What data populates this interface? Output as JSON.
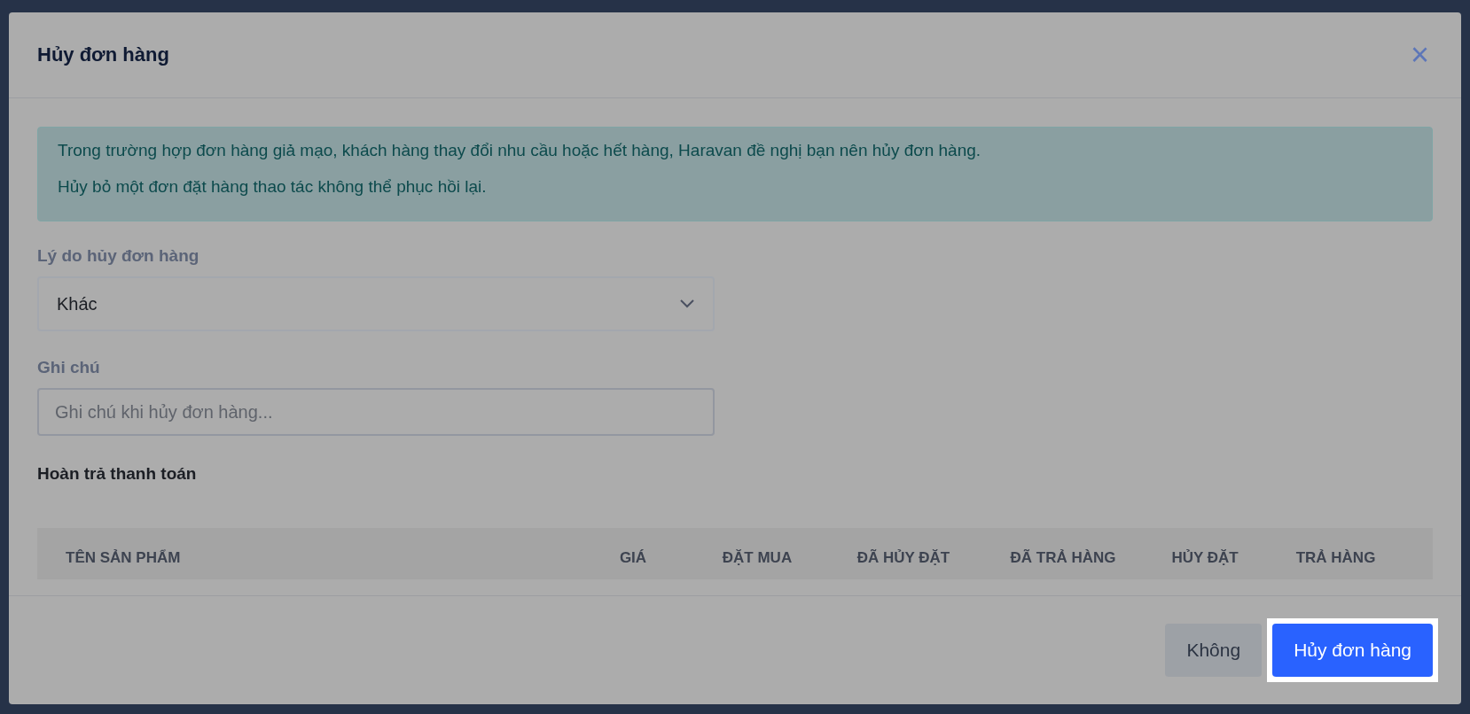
{
  "dialog": {
    "title": "Hủy đơn hàng",
    "close": "×"
  },
  "notice": [
    "Trong trường hợp đơn hàng giả mạo, khách hàng thay đổi nhu cầu hoặc hết hàng, Haravan đề nghị bạn nên hủy đơn hàng.",
    "Hủy bỏ một đơn đặt hàng thao tác không thể phục hồi lại."
  ],
  "reason": {
    "label": "Lý do hủy đơn hàng",
    "value": "Khác"
  },
  "note": {
    "label": "Ghi chú",
    "placeholder": "Ghi chú khi hủy đơn hàng..."
  },
  "refund": {
    "title": "Hoàn trả thanh toán",
    "columns": [
      "TÊN SẢN PHẨM",
      "GIÁ",
      "ĐẶT MUA",
      "ĐÃ HỦY ĐẶT",
      "ĐÃ TRẢ HÀNG",
      "HỦY ĐẶT",
      "TRẢ HÀNG"
    ]
  },
  "buttons": [
    {
      "label": "Không",
      "kind": "secondary",
      "highlighted": false
    },
    {
      "label": "Hủy đơn hàng",
      "kind": "primary",
      "highlighted": true
    }
  ]
}
